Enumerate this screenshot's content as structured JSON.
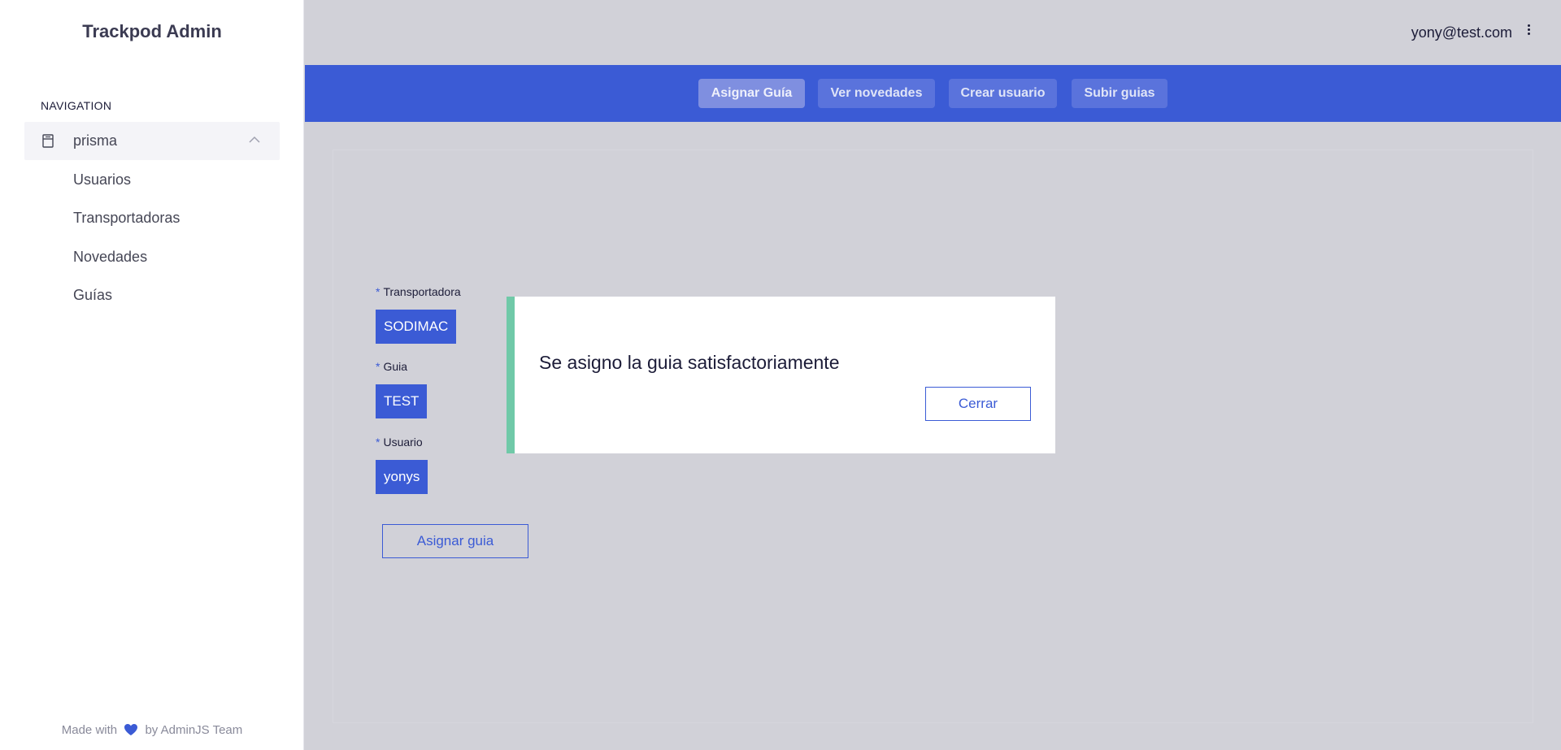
{
  "sidebar": {
    "brand": "Trackpod Admin",
    "nav_heading": "NAVIGATION",
    "group": {
      "label": "prisma",
      "icon": "database-icon",
      "expanded": true
    },
    "items": [
      {
        "label": "Usuarios"
      },
      {
        "label": "Transportadoras"
      },
      {
        "label": "Novedades"
      },
      {
        "label": "Guías"
      }
    ],
    "footer": {
      "prefix": "Made with",
      "suffix": "by AdminJS Team",
      "icon": "heart-icon"
    }
  },
  "header": {
    "user_email": "yony@test.com",
    "menu_icon": "kebab-menu-icon"
  },
  "actions": {
    "tabs": [
      {
        "label": "Asignar Guía",
        "active": true
      },
      {
        "label": "Ver novedades",
        "active": false
      },
      {
        "label": "Crear usuario",
        "active": false
      },
      {
        "label": "Subir guias",
        "active": false
      }
    ]
  },
  "form": {
    "required_mark": "*",
    "fields": [
      {
        "label": "Transportadora",
        "value": "SODIMAC"
      },
      {
        "label": "Guia",
        "value": "TEST"
      },
      {
        "label": "Usuario",
        "value": "yonys"
      }
    ],
    "submit_label": "Asignar guia"
  },
  "modal": {
    "message": "Se asigno la guia satisfactoriamente",
    "close_label": "Cerrar"
  },
  "colors": {
    "accent": "#3b5bd5",
    "success": "#70c9a8",
    "background": "#d1d1d8"
  }
}
